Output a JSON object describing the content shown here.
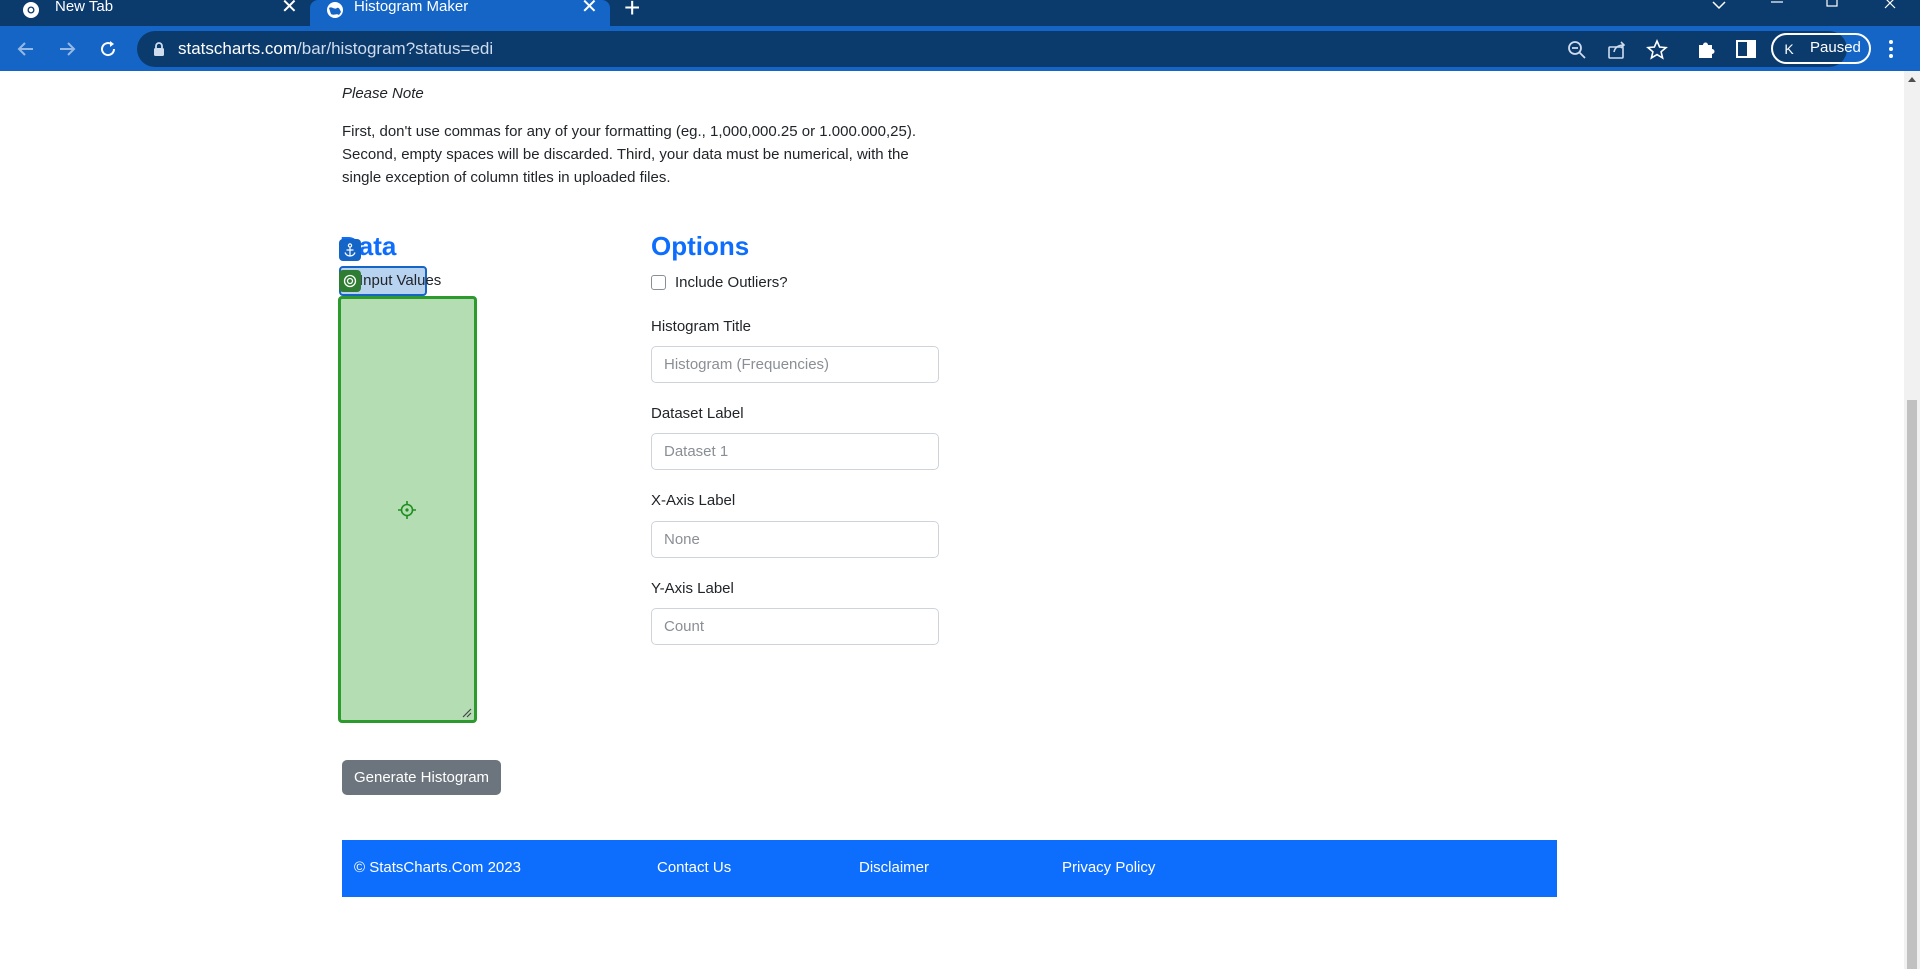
{
  "browser": {
    "tabs": [
      {
        "title": "New Tab",
        "icon": "chrome-icon",
        "active": false
      },
      {
        "title": "Histogram Maker",
        "icon": "globe-icon",
        "active": true
      }
    ],
    "close_glyph": "✕",
    "new_tab_glyph": "+",
    "url_host": "statscharts.com",
    "url_path": "/bar/histogram?status=edi",
    "profile": {
      "initial": "K",
      "status": "Paused"
    },
    "colors": {
      "tabstrip": "#0b3a6d",
      "toolbar": "#1565c6",
      "omnibox": "#0b3a6d"
    }
  },
  "note": {
    "title": "Please Note",
    "body": "First, don't use commas for any of your formatting (eg., 1,000,000.25 or 1.000.000,25). Second, empty spaces will be discarded. Third, your data must be numerical, with the single exception of column titles in uploaded files."
  },
  "data_section": {
    "heading": "Data",
    "input_label": "Input Values",
    "textarea_value": "",
    "highlight_colors": {
      "label_box": "#b8d3f0",
      "textarea": "#b4ddb4",
      "textarea_border": "#2d9a2d"
    }
  },
  "options": {
    "heading": "Options",
    "include_outliers_label": "Include Outliers?",
    "include_outliers_checked": false,
    "fields": [
      {
        "label": "Histogram Title",
        "value": "",
        "placeholder": "Histogram (Frequencies)"
      },
      {
        "label": "Dataset Label",
        "value": "",
        "placeholder": "Dataset 1"
      },
      {
        "label": "X-Axis Label",
        "value": "",
        "placeholder": "None"
      },
      {
        "label": "Y-Axis Label",
        "value": "",
        "placeholder": "Count"
      }
    ]
  },
  "actions": {
    "generate_label": "Generate Histogram"
  },
  "footer": {
    "copyright": "© StatsCharts.Com 2023",
    "links": [
      "Contact Us",
      "Disclaimer",
      "Privacy Policy"
    ],
    "color": "#0d6efd"
  }
}
